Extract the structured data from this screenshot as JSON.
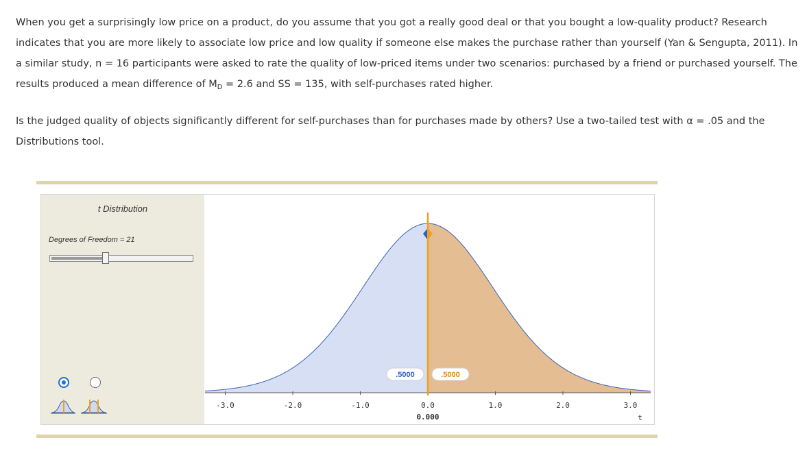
{
  "question": {
    "p1_a": "When you get a surprisingly low price on a product, do you assume that you got a really good deal or that you bought a low-quality product? Research indicates that you are more likely to associate low price and low quality if someone else makes the purchase rather than yourself (Yan & Sengupta, 2011). In a similar study, n = 16 participants were asked to rate the quality of low-priced items under two scenarios: purchased by a friend or purchased yourself. The results produced a mean difference of M",
    "p1_sub": "D",
    "p1_b": " = 2.6 and SS = 135, with self-purchases rated higher.",
    "p2": "Is the judged quality of objects significantly different for self-purchases than for purchases made by others? Use a two-tailed test with α = .05 and the Distributions tool."
  },
  "tool": {
    "title": "t Distribution",
    "df_label": "Degrees of Freedom = 21",
    "df_value": 21,
    "df_min": 1,
    "df_max": 50,
    "mode": "one-line",
    "mode_options": [
      "one-line",
      "two-lines"
    ],
    "colors": {
      "left_fill": "#d6dff4",
      "right_fill": "#e5bd93",
      "curve": "#3a63b8",
      "marker": "#f0a020",
      "left_label": "#2b5fc9",
      "right_label": "#e08a0a",
      "panel": "#ecebde",
      "rule": "#e0d3ab"
    },
    "icons": [
      "distribution-one-line-icon",
      "distribution-two-lines-icon"
    ]
  },
  "chart_data": {
    "type": "area",
    "distribution": "t",
    "df": 21,
    "xlim": [
      -3.3,
      3.3
    ],
    "x_ticks": [
      "-3.0",
      "-2.0",
      "-1.0",
      "0.0",
      "1.0",
      "2.0",
      "3.0"
    ],
    "x_tick_values": [
      -3,
      -2,
      -1,
      0,
      1,
      2,
      3
    ],
    "xlabel": "t",
    "marker_value": 0.0,
    "marker_label": "0.000",
    "left_area_label": ".5000",
    "right_area_label": ".5000"
  }
}
